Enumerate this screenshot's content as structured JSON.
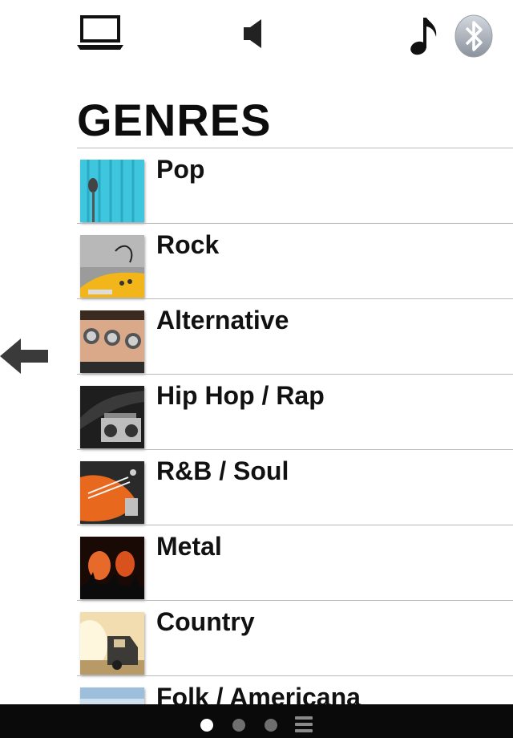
{
  "header": {
    "title": "GENRES",
    "icons": [
      "laptop-icon",
      "speaker-icon",
      "music-note-icon",
      "bluetooth-icon"
    ]
  },
  "genres": [
    {
      "label": "Pop",
      "thumb": "microphone-thumbnail"
    },
    {
      "label": "Rock",
      "thumb": "electric-guitar-thumbnail"
    },
    {
      "label": "Alternative",
      "thumb": "amplifier-knobs-thumbnail"
    },
    {
      "label": "Hip Hop / Rap",
      "thumb": "boombox-thumbnail"
    },
    {
      "label": "R&B / Soul",
      "thumb": "bass-guitar-thumbnail"
    },
    {
      "label": "Metal",
      "thumb": "concert-crowd-thumbnail"
    },
    {
      "label": "Country",
      "thumb": "pickup-truck-thumbnail"
    },
    {
      "label": "Folk / Americana",
      "thumb": "sky-thumbnail"
    }
  ],
  "pager": {
    "pages": 3,
    "active_page": 1,
    "menu_icon": "hamburger-menu-icon"
  },
  "colors": {
    "background": "#ffffff",
    "text": "#111111",
    "divider": "#b9b9b9",
    "bottom_bar": "#0a0a0a",
    "dot_active": "#ffffff",
    "dot_inactive": "#6f6f6f"
  }
}
